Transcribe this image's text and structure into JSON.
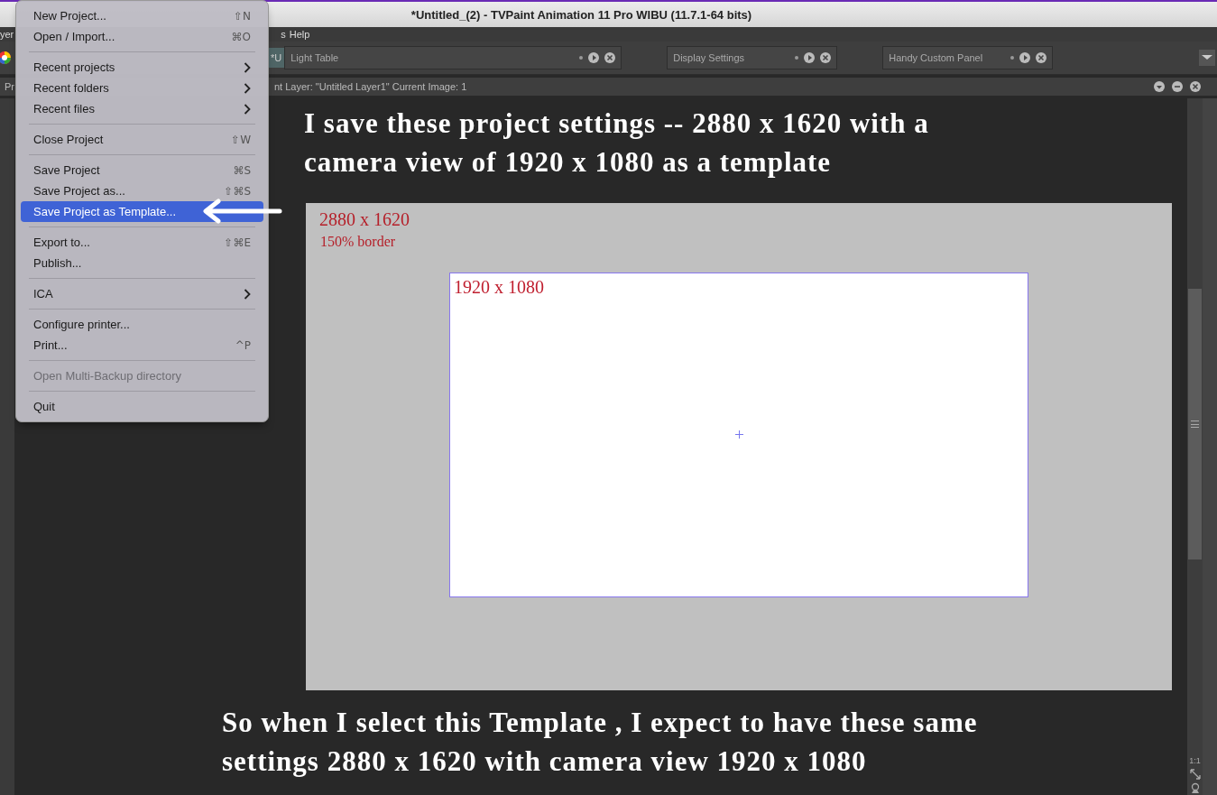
{
  "window": {
    "title": "*Untitled_(2) - TVPaint Animation 11 Pro WIBU (11.7.1-64 bits)"
  },
  "menubar": [
    {
      "label": "yer"
    },
    {
      "label": "s"
    },
    {
      "label": "Help"
    }
  ],
  "tabs": [
    {
      "label": "*U",
      "kind": "stub"
    },
    {
      "label": "Light Table",
      "kind": "panel"
    },
    {
      "label": "Display Settings",
      "kind": "panel"
    },
    {
      "label": "Handy Custom Panel",
      "kind": "panel"
    }
  ],
  "panel_header": {
    "left": "Pr",
    "info": "nt Layer: \"Untitled Layer1\"  Current Image: 1"
  },
  "file_menu": {
    "items": [
      {
        "kind": "item",
        "label": "New Project...",
        "shortcut": "⇧N",
        "submenu": false,
        "disabled": false,
        "selected": false
      },
      {
        "kind": "item",
        "label": "Open / Import...",
        "shortcut": "⌘O",
        "submenu": false,
        "disabled": false,
        "selected": false
      },
      {
        "kind": "separator"
      },
      {
        "kind": "item",
        "label": "Recent projects",
        "submenu": true,
        "disabled": false,
        "selected": false
      },
      {
        "kind": "item",
        "label": "Recent folders",
        "submenu": true,
        "disabled": false,
        "selected": false
      },
      {
        "kind": "item",
        "label": "Recent files",
        "submenu": true,
        "disabled": false,
        "selected": false
      },
      {
        "kind": "separator"
      },
      {
        "kind": "item",
        "label": "Close Project",
        "shortcut": "⇧W",
        "submenu": false,
        "disabled": false,
        "selected": false
      },
      {
        "kind": "separator"
      },
      {
        "kind": "item",
        "label": "Save Project",
        "shortcut": "⌘S",
        "submenu": false,
        "disabled": false,
        "selected": false
      },
      {
        "kind": "item",
        "label": "Save Project as...",
        "shortcut": "⇧⌘S",
        "submenu": false,
        "disabled": false,
        "selected": false
      },
      {
        "kind": "item",
        "label": "Save Project as Template...",
        "submenu": false,
        "disabled": false,
        "selected": true
      },
      {
        "kind": "separator"
      },
      {
        "kind": "item",
        "label": "Export to...",
        "shortcut": "⇧⌘E",
        "submenu": false,
        "disabled": false,
        "selected": false
      },
      {
        "kind": "item",
        "label": "Publish...",
        "submenu": false,
        "disabled": false,
        "selected": false
      },
      {
        "kind": "separator"
      },
      {
        "kind": "item",
        "label": "ICA",
        "submenu": true,
        "disabled": false,
        "selected": false
      },
      {
        "kind": "separator"
      },
      {
        "kind": "item",
        "label": "Configure printer...",
        "submenu": false,
        "disabled": false,
        "selected": false
      },
      {
        "kind": "item",
        "label": "Print...",
        "shortcut": "^P",
        "submenu": false,
        "disabled": false,
        "selected": false
      },
      {
        "kind": "separator"
      },
      {
        "kind": "item",
        "label": "Open Multi-Backup directory",
        "submenu": false,
        "disabled": true,
        "selected": false
      },
      {
        "kind": "separator"
      },
      {
        "kind": "item",
        "label": "Quit",
        "submenu": false,
        "disabled": false,
        "selected": false
      }
    ]
  },
  "annotations": [
    {
      "lines": [
        "I save these project settings  -- 2880 x 1620 with a",
        "camera view of 1920 x 1080 as a template"
      ]
    },
    {
      "lines": [
        "So when I select this Template , I expect to have these same",
        "settings 2880 x 1620 with camera view 1920 x 1080"
      ]
    }
  ],
  "canvas": {
    "label": "2880 x 1620",
    "sublabel": "150% border",
    "camera_label": "1920 x 1080"
  },
  "zoom_reset": "1:1"
}
